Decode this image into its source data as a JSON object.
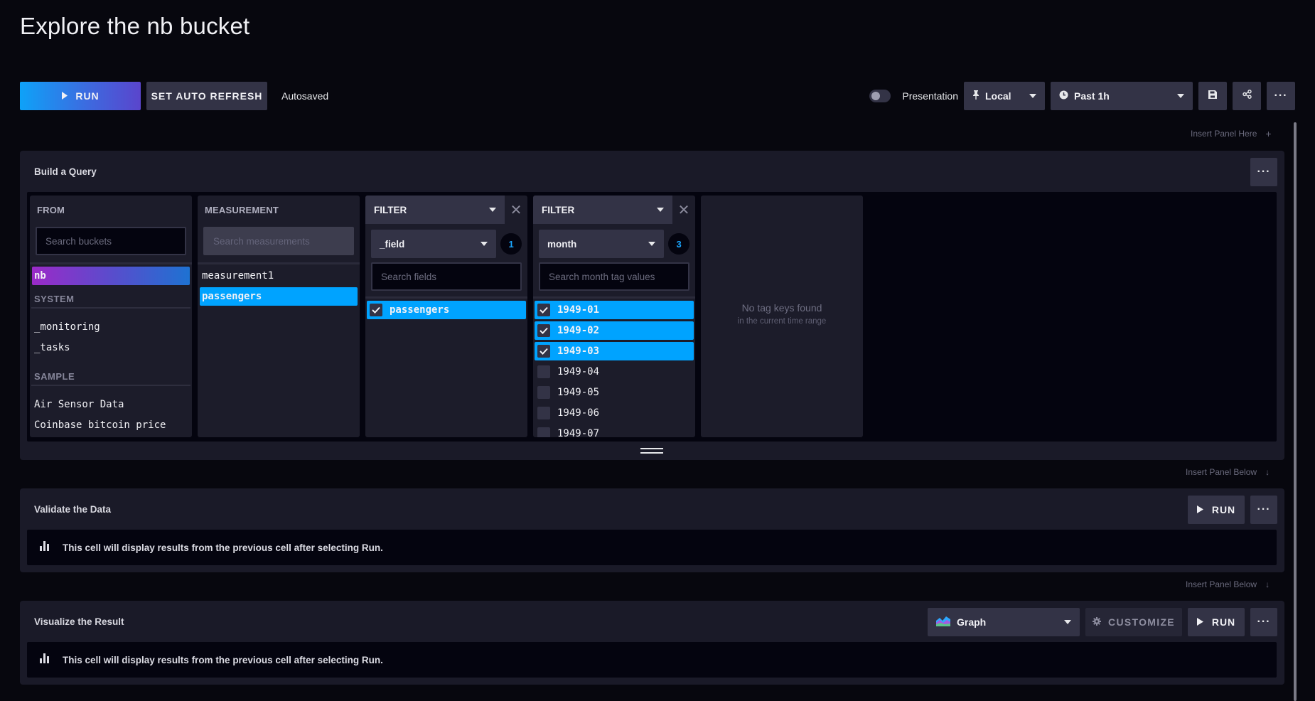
{
  "page": {
    "title": "Explore the nb bucket"
  },
  "toolbar": {
    "run_label": "RUN",
    "auto_refresh_label": "SET AUTO REFRESH",
    "autosave_status": "Autosaved",
    "presentation_label": "Presentation",
    "presentation_on": false,
    "timezone": "Local",
    "time_range": "Past 1h"
  },
  "insert": {
    "here": "Insert Panel Here",
    "below": "Insert Panel Below"
  },
  "query_panel": {
    "title": "Build a Query",
    "from": {
      "header": "FROM",
      "search_placeholder": "Search buckets",
      "selected_bucket": "nb",
      "groups": [
        {
          "label": "SYSTEM",
          "items": [
            "_monitoring",
            "_tasks"
          ]
        },
        {
          "label": "SAMPLE",
          "items": [
            "Air Sensor Data",
            "Coinbase bitcoin price"
          ]
        }
      ]
    },
    "measurement": {
      "header": "MEASUREMENT",
      "search_placeholder": "Search measurements",
      "items": [
        "measurement1",
        "passengers"
      ],
      "selected": "passengers"
    },
    "filter1": {
      "header": "FILTER",
      "key": "_field",
      "selected_count": "1",
      "search_placeholder": "Search fields",
      "items": [
        {
          "label": "passengers",
          "checked": true
        }
      ]
    },
    "filter2": {
      "header": "FILTER",
      "key": "month",
      "selected_count": "3",
      "search_placeholder": "Search month tag values",
      "items": [
        {
          "label": "1949-01",
          "checked": true
        },
        {
          "label": "1949-02",
          "checked": true
        },
        {
          "label": "1949-03",
          "checked": true
        },
        {
          "label": "1949-04",
          "checked": false
        },
        {
          "label": "1949-05",
          "checked": false
        },
        {
          "label": "1949-06",
          "checked": false
        },
        {
          "label": "1949-07",
          "checked": false
        }
      ]
    },
    "empty_filter": {
      "message": "No tag keys found",
      "submessage": "in the current time range"
    }
  },
  "validate_panel": {
    "title": "Validate the Data",
    "run_label": "RUN",
    "placeholder": "This cell will display results from the previous cell after selecting Run."
  },
  "visualize_panel": {
    "title": "Visualize the Result",
    "vis_type": "Graph",
    "customize_label": "CUSTOMIZE",
    "run_label": "RUN",
    "placeholder": "This cell will display results from the previous cell after selecting Run."
  },
  "colors": {
    "accent_blue": "#00a3ff",
    "badge_blue": "#1aa6ff",
    "background": "#07070e",
    "panel": "#1a1a28",
    "button": "#333346"
  }
}
